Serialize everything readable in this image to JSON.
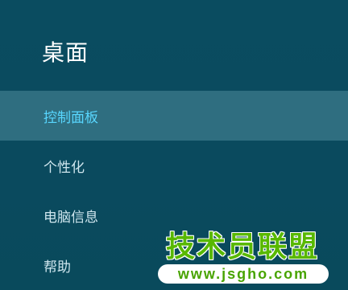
{
  "panel": {
    "title": "桌面"
  },
  "menu": {
    "items": [
      {
        "label": "控制面板",
        "selected": true
      },
      {
        "label": "个性化",
        "selected": false
      },
      {
        "label": "电脑信息",
        "selected": false
      },
      {
        "label": "帮助",
        "selected": false
      }
    ]
  },
  "watermark": {
    "title": "技术员联盟",
    "url": "www.jsgho.com"
  },
  "colors": {
    "background": "#0b4a5e",
    "selected_background": "#2f6e80",
    "selected_text": "#58d7ff",
    "text": "#cfe6ee",
    "watermark_green": "#58b800"
  }
}
